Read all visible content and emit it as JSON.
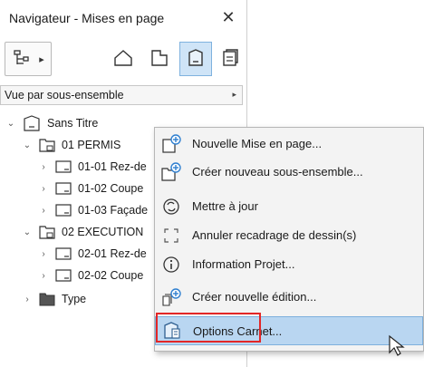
{
  "window": {
    "title": "Navigateur - Mises en page",
    "close_glyph": "✕"
  },
  "toolbar": {
    "first_icon": "project-map-icon",
    "first_arrow": "▸",
    "icons": [
      "house-icon",
      "layout-icon",
      "layout-book-icon",
      "publisher-icon"
    ]
  },
  "view_select": {
    "label": "Vue par sous-ensemble",
    "arrow": "▸"
  },
  "tree": [
    {
      "label": "Sans Titre",
      "expanded": true
    },
    {
      "label": "01 PERMIS",
      "expanded": true
    },
    {
      "label": "01-01 Rez-de"
    },
    {
      "label": "01-02 Coupe"
    },
    {
      "label": "01-03 Façade"
    },
    {
      "label": "02 EXECUTION",
      "expanded": true
    },
    {
      "label": "02-01 Rez-de"
    },
    {
      "label": "02-02 Coupe"
    },
    {
      "label": "Type"
    }
  ],
  "context_menu": {
    "items": [
      {
        "label": "Nouvelle Mise en page...",
        "icon": "new-layout-icon"
      },
      {
        "label": "Créer nouveau sous-ensemble...",
        "icon": "new-subset-icon"
      },
      {
        "label": "Mettre à jour",
        "icon": "update-icon"
      },
      {
        "label": "Annuler recadrage de dessin(s)",
        "icon": "crop-icon"
      },
      {
        "label": "Information Projet...",
        "icon": "info-icon"
      },
      {
        "label": "Créer nouvelle édition...",
        "icon": "new-issue-icon"
      },
      {
        "label": "Options Carnet...",
        "icon": "book-options-icon",
        "highlighted": true
      }
    ]
  },
  "colors": {
    "highlight": "#b9d6f1",
    "accent_border": "#e32626",
    "icon_blue": "#2f7fd0"
  }
}
